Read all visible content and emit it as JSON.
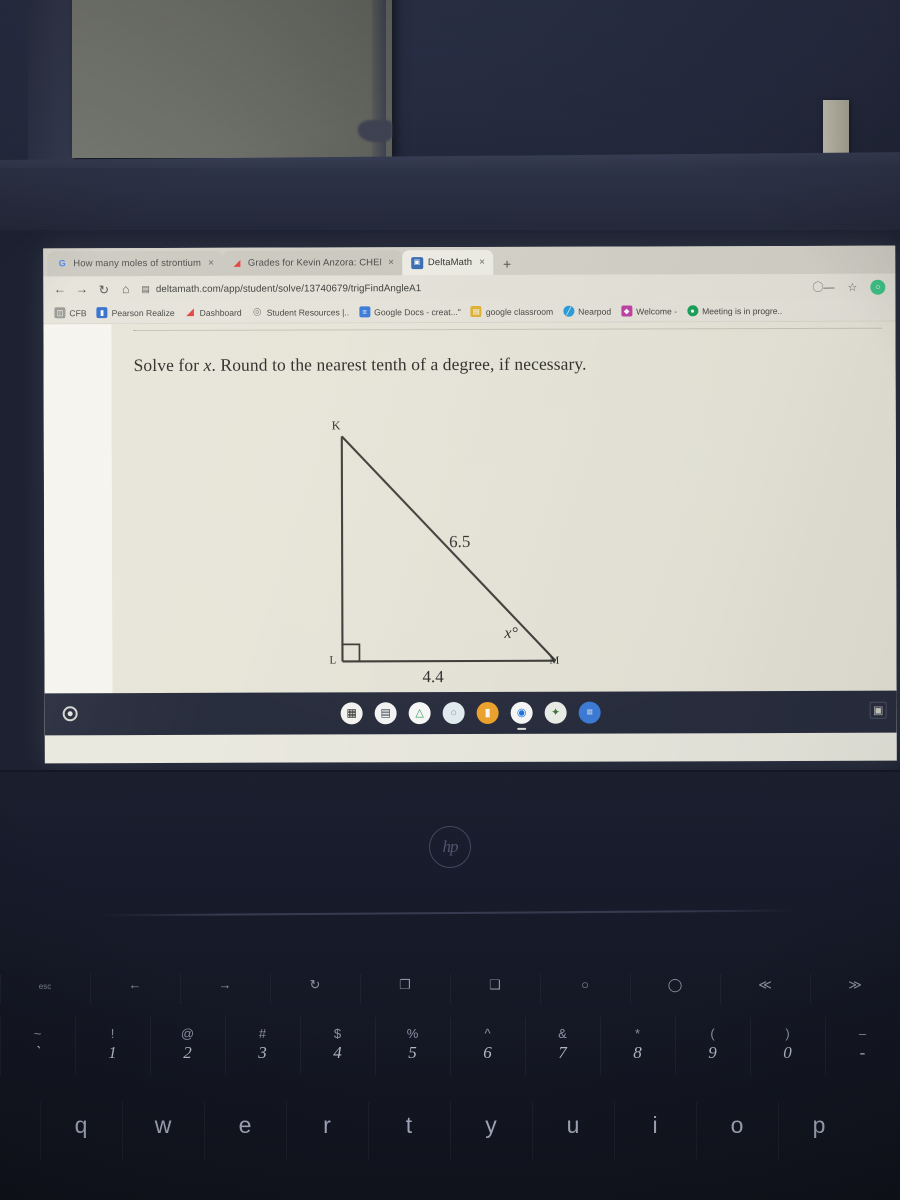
{
  "browser": {
    "tabs": [
      {
        "title": "How many moles of strontium",
        "favicon": "google-icon",
        "favicon_color": "#ffffff",
        "favicon_glyph": "G",
        "active": false
      },
      {
        "title": "Grades for Kevin Anzora: CHEM",
        "favicon": "canvas-icon",
        "favicon_color": "#e8433f",
        "favicon_glyph": "◢",
        "active": false
      },
      {
        "title": "DeltaMath",
        "favicon": "deltamath-icon",
        "favicon_color": "#3b6fb5",
        "favicon_glyph": "▣",
        "active": true
      }
    ],
    "new_tab_label": "+",
    "close_label": "×",
    "nav": {
      "back_icon": "←",
      "forward_icon": "→",
      "reload_icon": "↻",
      "home_icon": "⌂"
    },
    "address": {
      "site_icon": "page-info-icon",
      "domain": "deltamath.com",
      "path": "/app/student/solve/13740679/trigFindAngleA1",
      "full_url": "deltamath.com/app/student/solve/13740679/trigFindAngleA1"
    },
    "toolbar_right": [
      {
        "name": "password-key-icon",
        "glyph": "⊖"
      },
      {
        "name": "bookmark-star-icon",
        "glyph": "☆"
      },
      {
        "name": "profile-avatar",
        "glyph": "○",
        "color": "#3ec98a"
      }
    ],
    "bookmarks": [
      {
        "label": "CFB",
        "icon": "folder-icon",
        "glyph": "❐",
        "color": "#8d8d86"
      },
      {
        "label": "Pearson Realize",
        "icon": "pearson-icon",
        "glyph": "⬛",
        "color": "#2f6fd0"
      },
      {
        "label": "Dashboard",
        "icon": "canvas-icon",
        "glyph": "◢",
        "color": "#e8433f"
      },
      {
        "label": "Student Resources |..",
        "icon": "globe-icon",
        "glyph": "◎",
        "color": "#8d8d86"
      },
      {
        "label": "Google Docs - creat...\"",
        "icon": "google-docs-icon",
        "glyph": "≡",
        "color": "#3b7ddd"
      },
      {
        "label": "google classroom",
        "icon": "google-classroom-icon",
        "glyph": "▤",
        "color": "#e5b432"
      },
      {
        "label": "Nearpod",
        "icon": "nearpod-icon",
        "glyph": "⊘",
        "color": "#2b9fe0"
      },
      {
        "label": "Welcome -",
        "icon": "flipgrid-icon",
        "glyph": "◆",
        "color": "#c341a8"
      },
      {
        "label": "Meeting is in progre..",
        "icon": "zoom-meeting-icon",
        "glyph": "●",
        "color": "#1aa35a"
      }
    ]
  },
  "page": {
    "problem_prompt_part1": "Solve for ",
    "problem_variable": "x",
    "problem_prompt_part2": ". Round to the nearest tenth of a degree, if necessary."
  },
  "figure": {
    "type": "right-triangle",
    "vertices": {
      "top_left": "K",
      "bottom_left": "L",
      "bottom_right": "M"
    },
    "right_angle_at": "L",
    "hypotenuse_label": "6.5",
    "base_label": "4.4",
    "unknown_angle_label": "x°",
    "unknown_angle_at": "M"
  },
  "shelf": {
    "launcher_name": "chromeos-launcher",
    "apps": [
      {
        "name": "calculator-app",
        "glyph": "⬚",
        "bg": "#ffffff",
        "fg": "#2b2b2b"
      },
      {
        "name": "files-app",
        "glyph": "▤",
        "bg": "#fbfbfb",
        "fg": "#39474f"
      },
      {
        "name": "google-drive-app",
        "glyph": "△",
        "bg": "#ffffff",
        "fg": "#2f9e5e"
      },
      {
        "name": "clock-app",
        "glyph": "○",
        "bg": "#e8f2f8",
        "fg": "#7d9fb4"
      },
      {
        "name": "keep-notes-app",
        "glyph": "▮",
        "bg": "#f4a62a",
        "fg": "#ffffff"
      },
      {
        "name": "google-chrome-app",
        "glyph": "◉",
        "bg": "#ffffff",
        "fg": "#1a73e8",
        "running": true
      },
      {
        "name": "scratchpad-app",
        "glyph": "✦",
        "bg": "#f2f6ef",
        "fg": "#3c7a3c"
      },
      {
        "name": "google-docs-app",
        "glyph": "≡",
        "bg": "#3b7ddd",
        "fg": "#ffffff"
      }
    ],
    "tray_icon": "system-tray-icon",
    "tray_glyph": "▣"
  },
  "keyboard": {
    "function_row": [
      "esc",
      "←",
      "→",
      "↻",
      "❐",
      "❑",
      "○",
      "◯",
      "≪",
      "≫"
    ],
    "number_row_symbols": [
      "~",
      "!",
      "@",
      "#",
      "$",
      "%",
      "^",
      "&",
      "*",
      "(",
      ")",
      "–"
    ],
    "number_row_digits": [
      "`",
      "1",
      "2",
      "3",
      "4",
      "5",
      "6",
      "7",
      "8",
      "9",
      "0",
      "-"
    ],
    "letter_row": [
      "q",
      "w",
      "e",
      "r",
      "t",
      "y",
      "u",
      "i",
      "o",
      "p"
    ],
    "brand_label": "hp"
  }
}
